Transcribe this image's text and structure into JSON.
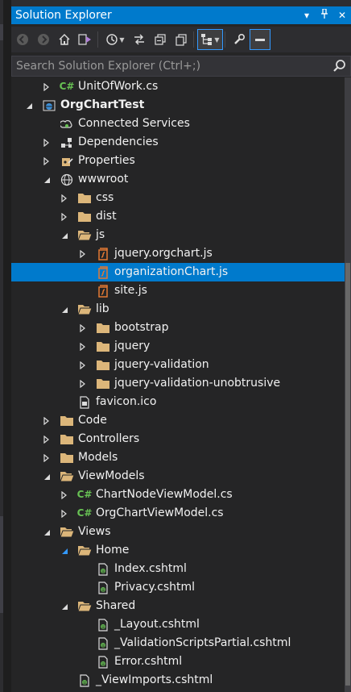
{
  "panel": {
    "title": "Solution Explorer",
    "title_controls": [
      "dropdown-icon",
      "pin-icon",
      "close-icon"
    ]
  },
  "toolbar": {
    "buttons": [
      "back-icon",
      "forward-icon",
      "home-icon",
      "vs-switch-views-icon",
      "history-icon",
      "sync-icon",
      "collapse-all-icon",
      "copy-icon",
      "show-all-files-icon",
      "properties-icon",
      "preview-icon"
    ]
  },
  "search": {
    "placeholder": "Search Solution Explorer (Ctrl+;)"
  },
  "colors": {
    "accent": "#007acc",
    "background": "#252526",
    "folder": "#dcb67a",
    "csharp": "#68c254",
    "js": "#e37933"
  },
  "tree": [
    {
      "label": "UnitOfWork.cs",
      "icon": "csharp-file-icon",
      "indent": 2,
      "expand": "collapsed"
    },
    {
      "label": "OrgChartTest",
      "icon": "web-project-icon",
      "indent": 1,
      "expand": "expanded",
      "bold": true
    },
    {
      "label": "Connected Services",
      "icon": "connected-services-icon",
      "indent": 2,
      "expand": "none"
    },
    {
      "label": "Dependencies",
      "icon": "dependencies-icon",
      "indent": 2,
      "expand": "collapsed"
    },
    {
      "label": "Properties",
      "icon": "properties-icon",
      "indent": 2,
      "expand": "collapsed"
    },
    {
      "label": "wwwroot",
      "icon": "globe-icon",
      "indent": 2,
      "expand": "expanded"
    },
    {
      "label": "css",
      "icon": "folder-icon",
      "indent": 3,
      "expand": "collapsed"
    },
    {
      "label": "dist",
      "icon": "folder-icon",
      "indent": 3,
      "expand": "collapsed"
    },
    {
      "label": "js",
      "icon": "folder-open-icon",
      "indent": 3,
      "expand": "expanded"
    },
    {
      "label": "jquery.orgchart.js",
      "icon": "js-file-icon",
      "indent": 4,
      "expand": "collapsed"
    },
    {
      "label": "organizationChart.js",
      "icon": "js-file-icon",
      "indent": 4,
      "expand": "none",
      "selected": true
    },
    {
      "label": "site.js",
      "icon": "js-file-icon",
      "indent": 4,
      "expand": "none"
    },
    {
      "label": "lib",
      "icon": "folder-open-icon",
      "indent": 3,
      "expand": "expanded"
    },
    {
      "label": "bootstrap",
      "icon": "folder-icon",
      "indent": 4,
      "expand": "collapsed"
    },
    {
      "label": "jquery",
      "icon": "folder-icon",
      "indent": 4,
      "expand": "collapsed"
    },
    {
      "label": "jquery-validation",
      "icon": "folder-icon",
      "indent": 4,
      "expand": "collapsed"
    },
    {
      "label": "jquery-validation-unobtrusive",
      "icon": "folder-icon",
      "indent": 4,
      "expand": "collapsed"
    },
    {
      "label": "favicon.ico",
      "icon": "icon-file-icon",
      "indent": 3,
      "expand": "none"
    },
    {
      "label": "Code",
      "icon": "folder-icon",
      "indent": 2,
      "expand": "collapsed"
    },
    {
      "label": "Controllers",
      "icon": "folder-icon",
      "indent": 2,
      "expand": "collapsed"
    },
    {
      "label": "Models",
      "icon": "folder-icon",
      "indent": 2,
      "expand": "collapsed"
    },
    {
      "label": "ViewModels",
      "icon": "folder-open-icon",
      "indent": 2,
      "expand": "expanded"
    },
    {
      "label": "ChartNodeViewModel.cs",
      "icon": "csharp-file-icon",
      "indent": 3,
      "expand": "collapsed"
    },
    {
      "label": "OrgChartViewModel.cs",
      "icon": "csharp-file-icon",
      "indent": 3,
      "expand": "collapsed"
    },
    {
      "label": "Views",
      "icon": "folder-open-icon",
      "indent": 2,
      "expand": "expanded"
    },
    {
      "label": "Home",
      "icon": "folder-open-icon",
      "indent": 3,
      "expand": "expanded-hot"
    },
    {
      "label": "Index.cshtml",
      "icon": "cshtml-file-icon",
      "indent": 4,
      "expand": "none"
    },
    {
      "label": "Privacy.cshtml",
      "icon": "cshtml-file-icon",
      "indent": 4,
      "expand": "none"
    },
    {
      "label": "Shared",
      "icon": "folder-open-icon",
      "indent": 3,
      "expand": "expanded"
    },
    {
      "label": "_Layout.cshtml",
      "icon": "cshtml-file-icon",
      "indent": 4,
      "expand": "none"
    },
    {
      "label": "_ValidationScriptsPartial.cshtml",
      "icon": "cshtml-file-icon",
      "indent": 4,
      "expand": "none"
    },
    {
      "label": "Error.cshtml",
      "icon": "cshtml-file-icon",
      "indent": 4,
      "expand": "none"
    },
    {
      "label": "_ViewImports.cshtml",
      "icon": "cshtml-file-icon",
      "indent": 3,
      "expand": "none"
    }
  ]
}
